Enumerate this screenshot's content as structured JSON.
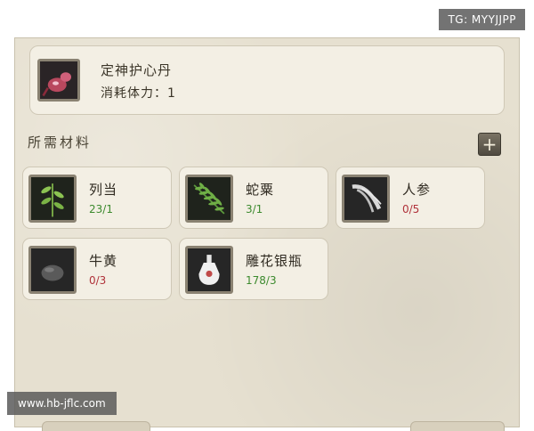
{
  "recipe": {
    "name": "定神护心丹",
    "cost": "消耗体力：1"
  },
  "materials_title": "所需材料",
  "add_button": "+",
  "materials": [
    {
      "name": "列当",
      "count": "23/1",
      "status": "enough",
      "icon": "herb-sprig-icon"
    },
    {
      "name": "蛇粟",
      "count": "3/1",
      "status": "enough",
      "icon": "fern-leaf-icon"
    },
    {
      "name": "人参",
      "count": "0/5",
      "status": "lacking",
      "icon": "ginseng-root-icon"
    },
    {
      "name": "牛黄",
      "count": "0/3",
      "status": "lacking",
      "icon": "stone-icon"
    },
    {
      "name": "雕花银瓶",
      "count": "178/3",
      "status": "enough",
      "icon": "silver-vase-icon"
    }
  ],
  "colors": {
    "enough": "#3c8a2e",
    "lacking": "#b0323a",
    "panel": "#e6e0d0"
  },
  "watermarks": {
    "top": "TG: MYYJJPP",
    "bottom": "www.hb-jflc.com"
  }
}
